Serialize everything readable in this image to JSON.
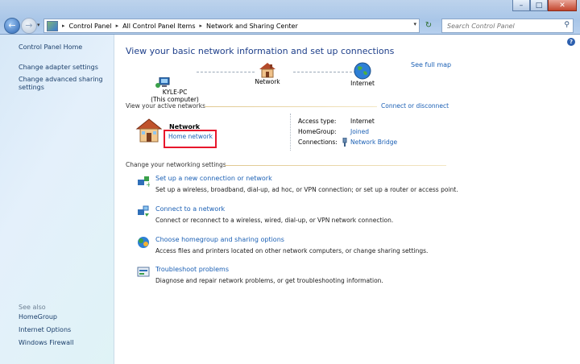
{
  "window": {
    "minimize": "–",
    "maximize": "□",
    "close": "✕"
  },
  "nav": {
    "back_glyph": "←",
    "forward_glyph": "→",
    "history_glyph": "▾"
  },
  "address": {
    "breadcrumb": [
      "Control Panel",
      "All Control Panel Items",
      "Network and Sharing Center"
    ],
    "separator": "▸",
    "dropdown_glyph": "▾",
    "refresh_glyph": "↻"
  },
  "search": {
    "placeholder": "Search Control Panel",
    "icon": "search-icon"
  },
  "sidebar": {
    "home": "Control Panel Home",
    "links": [
      "Change adapter settings",
      "Change advanced sharing",
      "settings"
    ],
    "see_also_title": "See also",
    "see_also": [
      "HomeGroup",
      "Internet Options",
      "Windows Firewall"
    ]
  },
  "main": {
    "help": "?",
    "heading": "View your basic network information and set up connections",
    "full_map": "See full map",
    "map": {
      "computer_name": "KYLE-PC",
      "computer_sub": "(This computer)",
      "network": "Network",
      "internet": "Internet"
    },
    "active": {
      "label": "View your active networks",
      "connect_link": "Connect or disconnect",
      "network_name": "Network",
      "network_type": "Home network",
      "access_type_label": "Access type:",
      "access_type_value": "Internet",
      "homegroup_label": "HomeGroup:",
      "homegroup_value": "Joined",
      "connections_label": "Connections:",
      "connections_value": "Network Bridge"
    },
    "settings": {
      "label": "Change your networking settings",
      "tasks": [
        {
          "title": "Set up a new connection or network",
          "desc": "Set up a wireless, broadband, dial-up, ad hoc, or VPN connection; or set up a router or access point."
        },
        {
          "title": "Connect to a network",
          "desc": "Connect or reconnect to a wireless, wired, dial-up, or VPN network connection."
        },
        {
          "title": "Choose homegroup and sharing options",
          "desc": "Access files and printers located on other network computers, or change sharing settings."
        },
        {
          "title": "Troubleshoot problems",
          "desc": "Diagnose and repair network problems, or get troubleshooting information."
        }
      ]
    }
  },
  "colors": {
    "link": "#1a5fb4",
    "highlight_box": "#e8172c",
    "heading": "#1e3f8a"
  }
}
